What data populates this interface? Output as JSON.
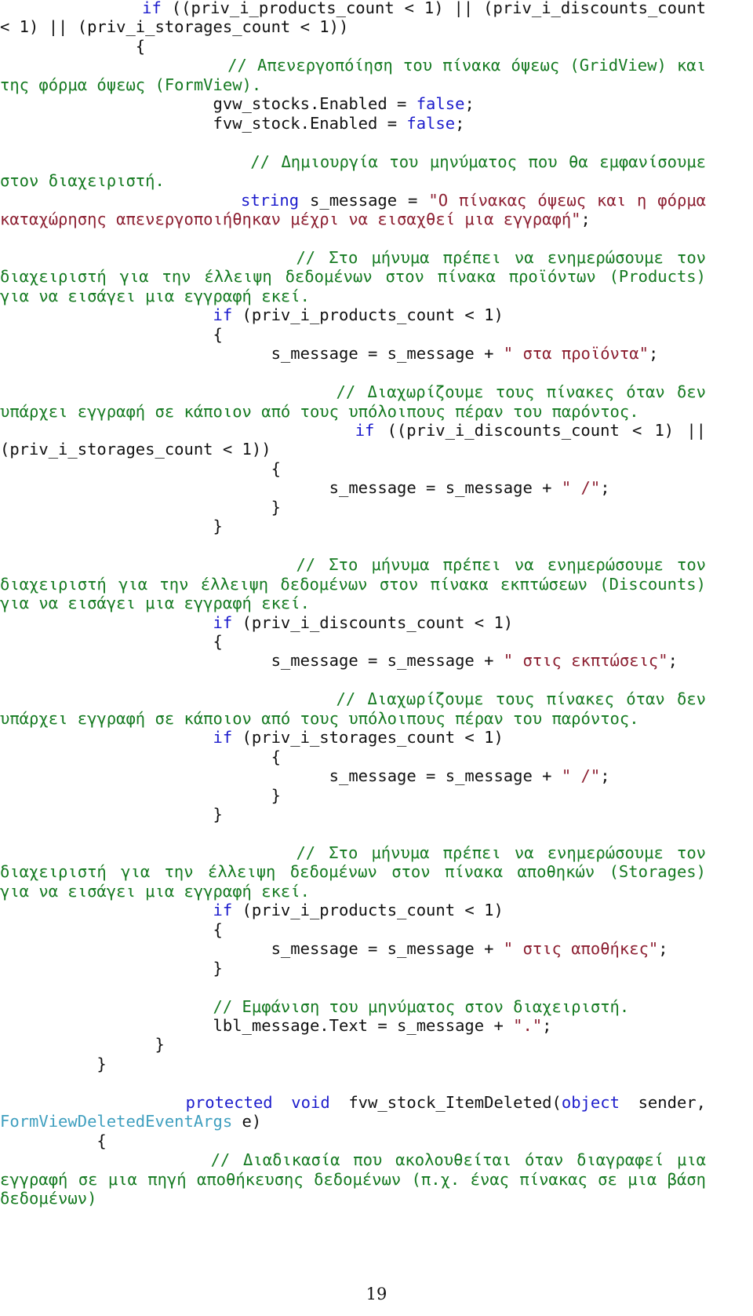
{
  "document": {
    "page_number": "19",
    "language": "csharp",
    "colors": {
      "keyword": "#1c1ccc",
      "type": "#3f9fbf",
      "string": "#8c1f31",
      "comment": "#157a21",
      "plain": "#111111",
      "background": "#ffffff"
    }
  },
  "code_lines": [
    {
      "indent": 7,
      "tokens": [
        {
          "t": "kw",
          "v": "if"
        },
        {
          "t": "pln",
          "v": " ((priv_i_products_count < 1) || (priv_i_discounts_count < 1) || (priv_i_storages_count < 1))"
        }
      ]
    },
    {
      "indent": 7,
      "tokens": [
        {
          "t": "pln",
          "v": "{"
        }
      ]
    },
    {
      "indent": 11,
      "tokens": [
        {
          "t": "com",
          "v": "// Απενεργοπόίηση του πίνακα όψεως (GridView) και της φόρμα όψεως (FormView)."
        }
      ]
    },
    {
      "indent": 11,
      "tokens": [
        {
          "t": "pln",
          "v": "gvw_stocks.Enabled = "
        },
        {
          "t": "kw",
          "v": "false"
        },
        {
          "t": "pln",
          "v": ";"
        }
      ]
    },
    {
      "indent": 11,
      "tokens": [
        {
          "t": "pln",
          "v": "fvw_stock.Enabled = "
        },
        {
          "t": "kw",
          "v": "false"
        },
        {
          "t": "pln",
          "v": ";"
        }
      ]
    },
    {
      "indent": 0,
      "tokens": []
    },
    {
      "indent": 11,
      "tokens": [
        {
          "t": "com",
          "v": "// Δημιουργία του μηνύματος που θα εμφανίσουμε στον διαχειριστή."
        }
      ]
    },
    {
      "indent": 11,
      "tokens": [
        {
          "t": "kw",
          "v": "string"
        },
        {
          "t": "pln",
          "v": " s_message = "
        },
        {
          "t": "str",
          "v": "\"Ο πίνακας όψεως και η φόρμα καταχώρησης απενεργοποιήθηκαν μέχρι να εισαχθεί μια εγγραφή\""
        },
        {
          "t": "pln",
          "v": ";"
        }
      ]
    },
    {
      "indent": 0,
      "tokens": []
    },
    {
      "indent": 11,
      "tokens": [
        {
          "t": "com",
          "v": "// Στο μήνυμα πρέπει να ενημερώσουμε τον διαχειριστή για την έλλειψη δεδομένων στον πίνακα προϊόντων (Products) για να εισάγει μια εγγραφή εκεί."
        }
      ]
    },
    {
      "indent": 11,
      "tokens": [
        {
          "t": "kw",
          "v": "if"
        },
        {
          "t": "pln",
          "v": " (priv_i_products_count < 1)"
        }
      ]
    },
    {
      "indent": 11,
      "tokens": [
        {
          "t": "pln",
          "v": "{"
        }
      ]
    },
    {
      "indent": 14,
      "tokens": [
        {
          "t": "pln",
          "v": "s_message = s_message + "
        },
        {
          "t": "str",
          "v": "\" στα προϊόντα\""
        },
        {
          "t": "pln",
          "v": ";"
        }
      ]
    },
    {
      "indent": 0,
      "tokens": []
    },
    {
      "indent": 14,
      "tokens": [
        {
          "t": "com",
          "v": "// Διαχωρίζουμε τους πίνακες όταν δεν υπάρχει εγγραφή σε κάποιον από τους υπόλοιπους πέραν του παρόντος."
        }
      ]
    },
    {
      "indent": 14,
      "tokens": [
        {
          "t": "kw",
          "v": "if"
        },
        {
          "t": "pln",
          "v": " ((priv_i_discounts_count < 1) || (priv_i_storages_count < 1))"
        }
      ]
    },
    {
      "indent": 14,
      "tokens": [
        {
          "t": "pln",
          "v": "{"
        }
      ]
    },
    {
      "indent": 17,
      "tokens": [
        {
          "t": "pln",
          "v": "s_message = s_message + "
        },
        {
          "t": "str",
          "v": "\" /\""
        },
        {
          "t": "pln",
          "v": ";"
        }
      ]
    },
    {
      "indent": 14,
      "tokens": [
        {
          "t": "pln",
          "v": "}"
        }
      ]
    },
    {
      "indent": 11,
      "tokens": [
        {
          "t": "pln",
          "v": "}"
        }
      ]
    },
    {
      "indent": 0,
      "tokens": []
    },
    {
      "indent": 11,
      "tokens": [
        {
          "t": "com",
          "v": "// Στο μήνυμα πρέπει να ενημερώσουμε τον διαχειριστή για την έλλειψη δεδομένων στον πίνακα εκπτώσεων (Discounts) για να εισάγει μια εγγραφή εκεί."
        }
      ]
    },
    {
      "indent": 11,
      "tokens": [
        {
          "t": "kw",
          "v": "if"
        },
        {
          "t": "pln",
          "v": " (priv_i_discounts_count < 1)"
        }
      ]
    },
    {
      "indent": 11,
      "tokens": [
        {
          "t": "pln",
          "v": "{"
        }
      ]
    },
    {
      "indent": 14,
      "tokens": [
        {
          "t": "pln",
          "v": "s_message = s_message + "
        },
        {
          "t": "str",
          "v": "\" στις εκπτώσεις\""
        },
        {
          "t": "pln",
          "v": ";"
        }
      ]
    },
    {
      "indent": 0,
      "tokens": []
    },
    {
      "indent": 14,
      "tokens": [
        {
          "t": "com",
          "v": "// Διαχωρίζουμε τους πίνακες όταν δεν υπάρχει εγγραφή σε κάποιον από τους υπόλοιπους πέραν του παρόντος."
        }
      ]
    },
    {
      "indent": 11,
      "tokens": [
        {
          "t": "kw",
          "v": "if"
        },
        {
          "t": "pln",
          "v": " (priv_i_storages_count < 1)"
        }
      ]
    },
    {
      "indent": 14,
      "tokens": [
        {
          "t": "pln",
          "v": "{"
        }
      ]
    },
    {
      "indent": 17,
      "tokens": [
        {
          "t": "pln",
          "v": "s_message = s_message + "
        },
        {
          "t": "str",
          "v": "\" /\""
        },
        {
          "t": "pln",
          "v": ";"
        }
      ]
    },
    {
      "indent": 14,
      "tokens": [
        {
          "t": "pln",
          "v": "}"
        }
      ]
    },
    {
      "indent": 11,
      "tokens": [
        {
          "t": "pln",
          "v": "}"
        }
      ]
    },
    {
      "indent": 0,
      "tokens": []
    },
    {
      "indent": 11,
      "tokens": [
        {
          "t": "com",
          "v": "// Στο μήνυμα πρέπει να ενημερώσουμε τον διαχειριστή για την έλλειψη δεδομένων στον πίνακα αποθηκών (Storages) για να εισάγει μια εγγραφή εκεί."
        }
      ]
    },
    {
      "indent": 11,
      "tokens": [
        {
          "t": "kw",
          "v": "if"
        },
        {
          "t": "pln",
          "v": " (priv_i_products_count < 1)"
        }
      ]
    },
    {
      "indent": 11,
      "tokens": [
        {
          "t": "pln",
          "v": "{"
        }
      ]
    },
    {
      "indent": 14,
      "tokens": [
        {
          "t": "pln",
          "v": "s_message = s_message + "
        },
        {
          "t": "str",
          "v": "\" στις αποθήκες\""
        },
        {
          "t": "pln",
          "v": ";"
        }
      ]
    },
    {
      "indent": 11,
      "tokens": [
        {
          "t": "pln",
          "v": "}"
        }
      ]
    },
    {
      "indent": 0,
      "tokens": []
    },
    {
      "indent": 11,
      "tokens": [
        {
          "t": "com",
          "v": "// Εμφάνιση του μηνύματος στον διαχειριστή."
        }
      ]
    },
    {
      "indent": 11,
      "tokens": [
        {
          "t": "pln",
          "v": "lbl_message.Text = s_message + "
        },
        {
          "t": "str",
          "v": "\".\""
        },
        {
          "t": "pln",
          "v": ";"
        }
      ]
    },
    {
      "indent": 8,
      "tokens": [
        {
          "t": "pln",
          "v": "}"
        }
      ]
    },
    {
      "indent": 5,
      "tokens": [
        {
          "t": "pln",
          "v": "}"
        }
      ]
    },
    {
      "indent": 0,
      "tokens": []
    },
    {
      "indent": 5,
      "tokens": [
        {
          "t": "kw",
          "v": "protected void"
        },
        {
          "t": "pln",
          "v": " fvw_stock_ItemDeleted("
        },
        {
          "t": "kw",
          "v": "object"
        },
        {
          "t": "pln",
          "v": " sender, "
        },
        {
          "t": "typ",
          "v": "FormViewDeletedEventArgs"
        },
        {
          "t": "pln",
          "v": " e)"
        }
      ]
    },
    {
      "indent": 5,
      "tokens": [
        {
          "t": "pln",
          "v": "{"
        }
      ]
    },
    {
      "indent": 8,
      "tokens": [
        {
          "t": "com",
          "v": "// Διαδικασία που ακολουθείται όταν διαγραφεί μια εγγραφή σε μια πηγή αποθήκευσης δεδομένων (π.χ. ένας πίνακας σε μια βάση δεδομένων)"
        }
      ]
    }
  ]
}
